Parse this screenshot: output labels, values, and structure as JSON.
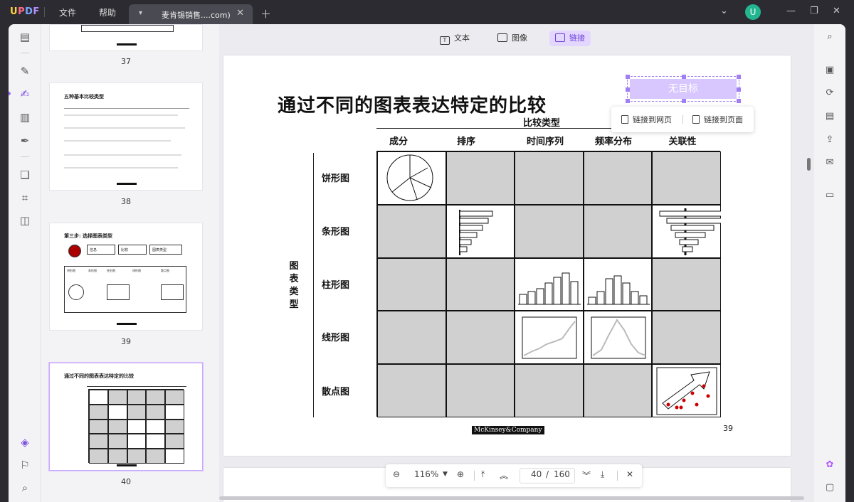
{
  "app": {
    "logo": "UPDF",
    "menu": [
      "文件",
      "帮助"
    ],
    "tab_title": "麦肯锡销售....com)",
    "avatar_letter": "U"
  },
  "toolbar": {
    "text_label": "文本",
    "image_label": "图像",
    "link_label": "链接"
  },
  "thumbnails": [
    {
      "page": "37"
    },
    {
      "page": "38",
      "title": "五种基本比较类型"
    },
    {
      "page": "39",
      "title": "第三步: 选择图表类型",
      "steps": [
        "信息",
        "比较",
        "图表类型"
      ],
      "labels": [
        "饼形图",
        "条形图",
        "柱形图",
        "线形图",
        "散点图"
      ]
    },
    {
      "page": "40",
      "title": "通过不同的图表表达特定的比较",
      "selected": true
    }
  ],
  "page": {
    "title": "通过不同的图表表达特定的比较",
    "comparison_label": "比较类型",
    "columns": [
      "成分",
      "排序",
      "时间序列",
      "频率分布",
      "关联性"
    ],
    "rows": [
      "饼形图",
      "条形图",
      "柱形图",
      "线形图",
      "散点图"
    ],
    "chart_type_label": "图表类型",
    "footer_brand": "McKinsey&Company",
    "page_number": "39",
    "filled_cells": [
      [
        0,
        0
      ],
      [
        1,
        1
      ],
      [
        1,
        4
      ],
      [
        2,
        2
      ],
      [
        2,
        3
      ],
      [
        3,
        2
      ],
      [
        3,
        3
      ],
      [
        4,
        4
      ]
    ]
  },
  "link_widget": {
    "placeholder": "无目标",
    "option_web": "链接到网页",
    "option_page": "链接到页面"
  },
  "nav": {
    "zoom": "116%",
    "current_page": "40",
    "separator": "/",
    "total_pages": "160"
  },
  "colors": {
    "accent": "#9b6dff",
    "cell_gray": "#d0d0d0"
  }
}
